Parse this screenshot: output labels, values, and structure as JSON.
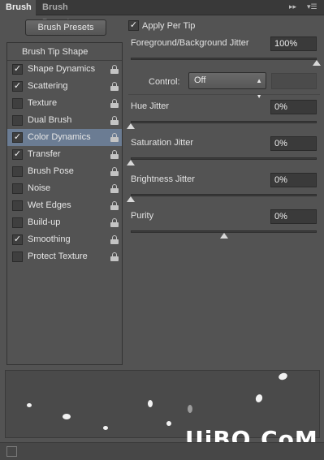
{
  "tabs": {
    "active": "Brush",
    "inactive": "Brush Presets"
  },
  "left": {
    "presets_button": "Brush Presets",
    "list_header": "Brush Tip Shape",
    "items": [
      {
        "label": "Shape Dynamics",
        "checked": true
      },
      {
        "label": "Scattering",
        "checked": true
      },
      {
        "label": "Texture",
        "checked": false
      },
      {
        "label": "Dual Brush",
        "checked": false
      },
      {
        "label": "Color Dynamics",
        "checked": true,
        "selected": true
      },
      {
        "label": "Transfer",
        "checked": true
      },
      {
        "label": "Brush Pose",
        "checked": false
      },
      {
        "label": "Noise",
        "checked": false
      },
      {
        "label": "Wet Edges",
        "checked": false
      },
      {
        "label": "Build-up",
        "checked": false
      },
      {
        "label": "Smoothing",
        "checked": true
      },
      {
        "label": "Protect Texture",
        "checked": false
      }
    ]
  },
  "right": {
    "apply_per_tip": {
      "label": "Apply Per Tip",
      "checked": true
    },
    "fg_bg_jitter": {
      "label": "Foreground/Background Jitter",
      "value": "100%",
      "level": 1.0
    },
    "control": {
      "label": "Control:",
      "value": "Off"
    },
    "hue_jitter": {
      "label": "Hue Jitter",
      "value": "0%",
      "level": 0.0
    },
    "saturation_jitter": {
      "label": "Saturation Jitter",
      "value": "0%",
      "level": 0.0
    },
    "brightness_jitter": {
      "label": "Brightness Jitter",
      "value": "0%",
      "level": 0.0
    },
    "purity": {
      "label": "Purity",
      "value": "0%",
      "level": 0.5
    }
  },
  "watermark": "UiBQ.CoM",
  "colors": {
    "panel_bg": "#535353",
    "selected_row": "#6b7c93"
  }
}
